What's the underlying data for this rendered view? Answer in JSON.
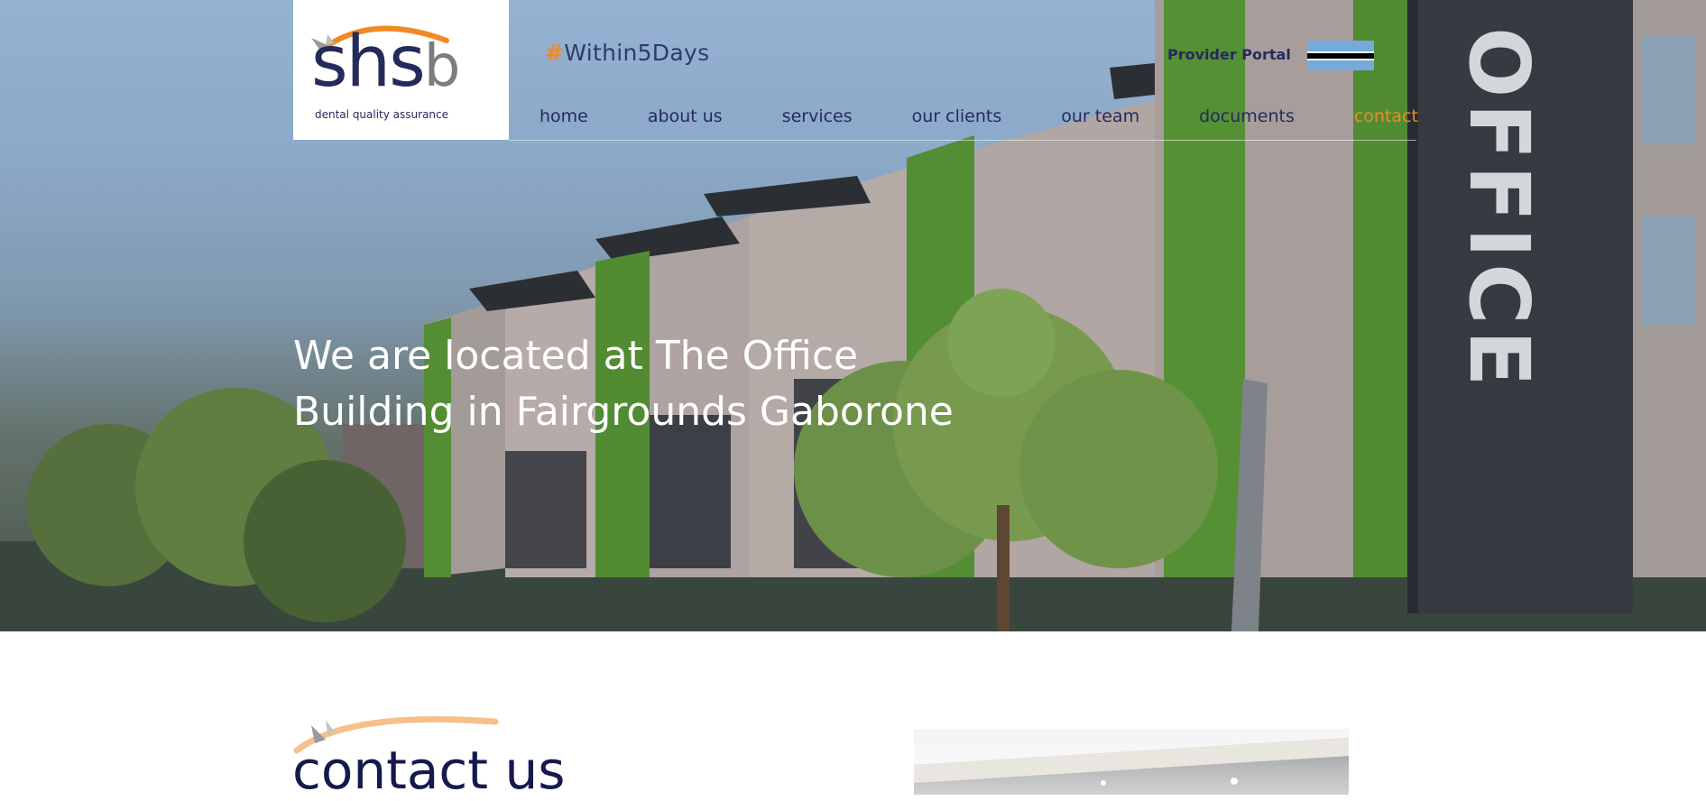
{
  "header": {
    "logo": {
      "wordmark": "shsb",
      "tagline": "dental quality assurance"
    },
    "hashtag": {
      "symbol": "#",
      "text": "Within5Days"
    },
    "provider_portal": "Provider Portal",
    "flag_icon": "botswana-flag-icon"
  },
  "nav": {
    "items": [
      {
        "label": "home"
      },
      {
        "label": "about us"
      },
      {
        "label": "services"
      },
      {
        "label": "our clients"
      },
      {
        "label": "our team"
      },
      {
        "label": "documents"
      },
      {
        "label": "contact"
      }
    ],
    "active_index": 6
  },
  "hero": {
    "title": "We are located at The Office Building in Fairgrounds Gaborone",
    "sign_text": "OFFICE"
  },
  "contact": {
    "title": "contact us"
  },
  "colors": {
    "navy": "#252a5c",
    "orange": "#f08a24",
    "green": "#5e9e34",
    "sky": "#a9c6e8"
  }
}
